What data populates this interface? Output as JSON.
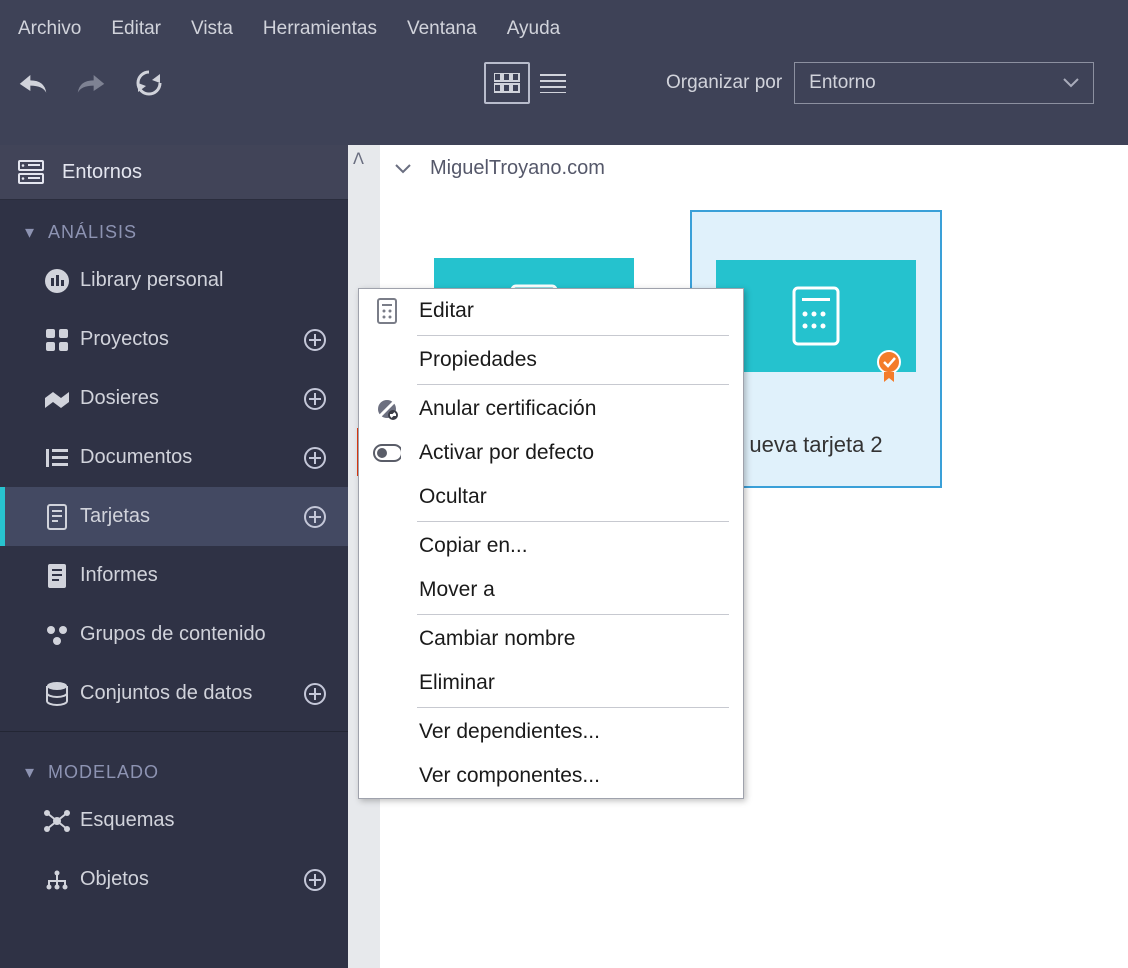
{
  "menubar": [
    "Archivo",
    "Editar",
    "Vista",
    "Herramientas",
    "Ventana",
    "Ayuda"
  ],
  "toolbar": {
    "organize_label": "Organizar por",
    "organize_value": "Entorno"
  },
  "sidebar": {
    "top_label": "Entornos",
    "section_analisis": "ANÁLISIS",
    "section_modelado": "MODELADO",
    "items_analisis": [
      {
        "label": "Library personal",
        "plus": false
      },
      {
        "label": "Proyectos",
        "plus": true
      },
      {
        "label": "Dosieres",
        "plus": true
      },
      {
        "label": "Documentos",
        "plus": true
      },
      {
        "label": "Tarjetas",
        "plus": true,
        "active": true
      },
      {
        "label": "Informes",
        "plus": false
      },
      {
        "label": "Grupos de contenido",
        "plus": false
      },
      {
        "label": "Conjuntos de datos",
        "plus": true
      }
    ],
    "items_modelado": [
      {
        "label": "Esquemas",
        "plus": false
      },
      {
        "label": "Objetos",
        "plus": true
      }
    ]
  },
  "breadcrumb": {
    "label": "MiguelTroyano.com"
  },
  "cards": [
    {
      "title": "",
      "selected": false,
      "certified": false
    },
    {
      "title": "ueva tarjeta 2",
      "selected": true,
      "certified": true
    }
  ],
  "context_menu": {
    "items": [
      {
        "label": "Editar",
        "icon": "card-icon"
      },
      {
        "sep": true
      },
      {
        "label": "Propiedades"
      },
      {
        "sep": true
      },
      {
        "label": "Anular certificación",
        "icon": "cert-off-icon"
      },
      {
        "label": "Activar por defecto",
        "icon": "toggle-icon",
        "highlight": true
      },
      {
        "label": "Ocultar"
      },
      {
        "sep": true
      },
      {
        "label": "Copiar en..."
      },
      {
        "label": "Mover a"
      },
      {
        "sep": true
      },
      {
        "label": "Cambiar nombre"
      },
      {
        "label": "Eliminar"
      },
      {
        "sep": true
      },
      {
        "label": "Ver dependientes..."
      },
      {
        "label": "Ver componentes..."
      }
    ]
  }
}
